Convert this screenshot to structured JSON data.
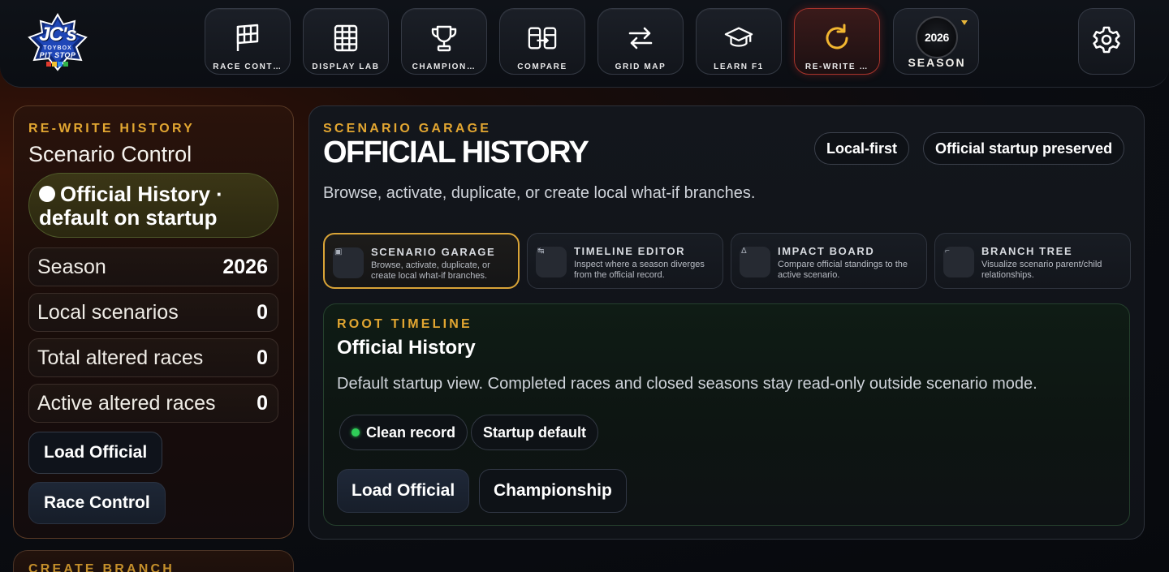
{
  "logo": {
    "line1": "JC's",
    "line2": "TOYBOX",
    "line3": "PIT STOP"
  },
  "nav": [
    {
      "label": "RACE CONT…",
      "icon": "checkered-flag-icon"
    },
    {
      "label": "DISPLAY LAB",
      "icon": "grid-icon"
    },
    {
      "label": "CHAMPION…",
      "icon": "trophy-icon"
    },
    {
      "label": "COMPARE",
      "icon": "compare-icon"
    },
    {
      "label": "GRID MAP",
      "icon": "swap-arrows-icon"
    },
    {
      "label": "LEARN F1",
      "icon": "graduation-cap-icon"
    },
    {
      "label": "RE-WRITE …",
      "icon": "refresh-icon"
    }
  ],
  "season_selector": {
    "year": "2026",
    "label": "SEASON"
  },
  "left": {
    "eyebrow": "RE-WRITE HISTORY",
    "title": "Scenario Control",
    "status": "Official History · default on startup",
    "stats": [
      {
        "label": "Season",
        "value": "2026"
      },
      {
        "label": "Local scenarios",
        "value": "0"
      },
      {
        "label": "Total altered races",
        "value": "0"
      },
      {
        "label": "Active altered races",
        "value": "0"
      }
    ],
    "load_official": "Load Official",
    "race_control": "Race Control",
    "next_eyebrow": "CREATE BRANCH"
  },
  "main": {
    "eyebrow": "SCENARIO GARAGE",
    "title": "OFFICIAL HISTORY",
    "chips": [
      "Local-first",
      "Official startup preserved"
    ],
    "description": "Browse, activate, duplicate, or create local what-if branches.",
    "cards": [
      {
        "title": "SCENARIO GARAGE",
        "desc": "Browse, activate, duplicate, or create local what-if branches.",
        "mark": "▣"
      },
      {
        "title": "TIMELINE EDITOR",
        "desc": "Inspect where a season diverges from the official record.",
        "mark": "↹"
      },
      {
        "title": "IMPACT BOARD",
        "desc": "Compare official standings to the active scenario.",
        "mark": "Δ"
      },
      {
        "title": "BRANCH TREE",
        "desc": "Visualize scenario parent/child relationships.",
        "mark": "⌐"
      }
    ],
    "root": {
      "eyebrow": "ROOT TIMELINE",
      "title": "Official History",
      "description": "Default startup view. Completed races and closed seasons stay read-only outside scenario mode.",
      "chips": [
        "Clean record",
        "Startup default"
      ],
      "buttons": [
        "Load Official",
        "Championship"
      ]
    }
  },
  "colors": {
    "accent": "#e2a631",
    "active_red": "#a8342c",
    "ok_green": "#2fcf58"
  }
}
